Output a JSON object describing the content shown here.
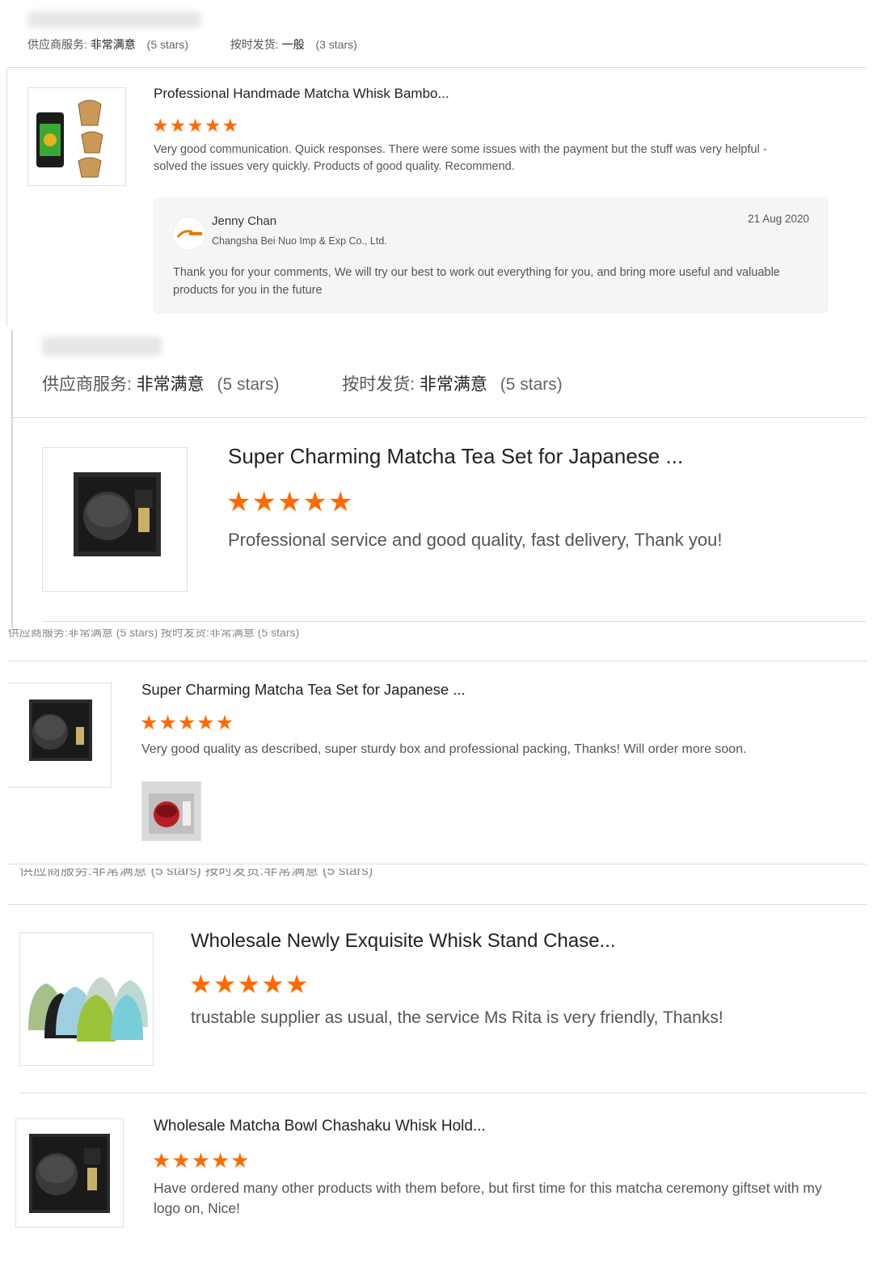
{
  "ratings_labels": {
    "supplier_service": "供应商服务:",
    "on_time": "按时发货:"
  },
  "sections": [
    {
      "supplier_value": "非常满意",
      "supplier_stars": "(5 stars)",
      "ontime_value": "一般",
      "ontime_stars": "(3 stars)",
      "product_title": "Professional Handmade Matcha Whisk Bambo...",
      "rating": 5,
      "review": "Very good communication. Quick responses. There were some issues with the payment but the stuff was very helpful - solved the issues very quickly. Products of good quality. Recommend.",
      "reply": {
        "name": "Jenny Chan",
        "company": "Changsha Bei Nuo Imp & Exp Co., Ltd.",
        "date": "21 Aug 2020",
        "text": "Thank you for your comments, We will try our best to work out everything for you, and bring more useful and valuable products for you in the future"
      }
    },
    {
      "supplier_value": "非常满意",
      "supplier_stars": "(5 stars)",
      "ontime_value": "非常满意",
      "ontime_stars": "(5 stars)",
      "product_title": "Super Charming Matcha Tea Set for Japanese ...",
      "rating": 5,
      "review": "Professional service and good quality, fast delivery, Thank you!"
    },
    {
      "product_title": "Super Charming Matcha Tea Set for Japanese ...",
      "rating": 5,
      "review": "Very good quality as described, super sturdy box and professional packing, Thanks! Will order more soon."
    },
    {
      "product_title": "Wholesale Newly Exquisite Whisk Stand Chase...",
      "rating": 5,
      "review": "trustable supplier as usual, the service Ms Rita is very friendly, Thanks!"
    },
    {
      "product_title": "Wholesale Matcha Bowl Chashaku Whisk Hold...",
      "rating": 5,
      "review": "Have ordered many other products with them before,  but first time for this matcha ceremony giftset with my logo on, Nice!"
    }
  ],
  "icons": {
    "star": "star-icon",
    "accent": "#ff6a00"
  }
}
